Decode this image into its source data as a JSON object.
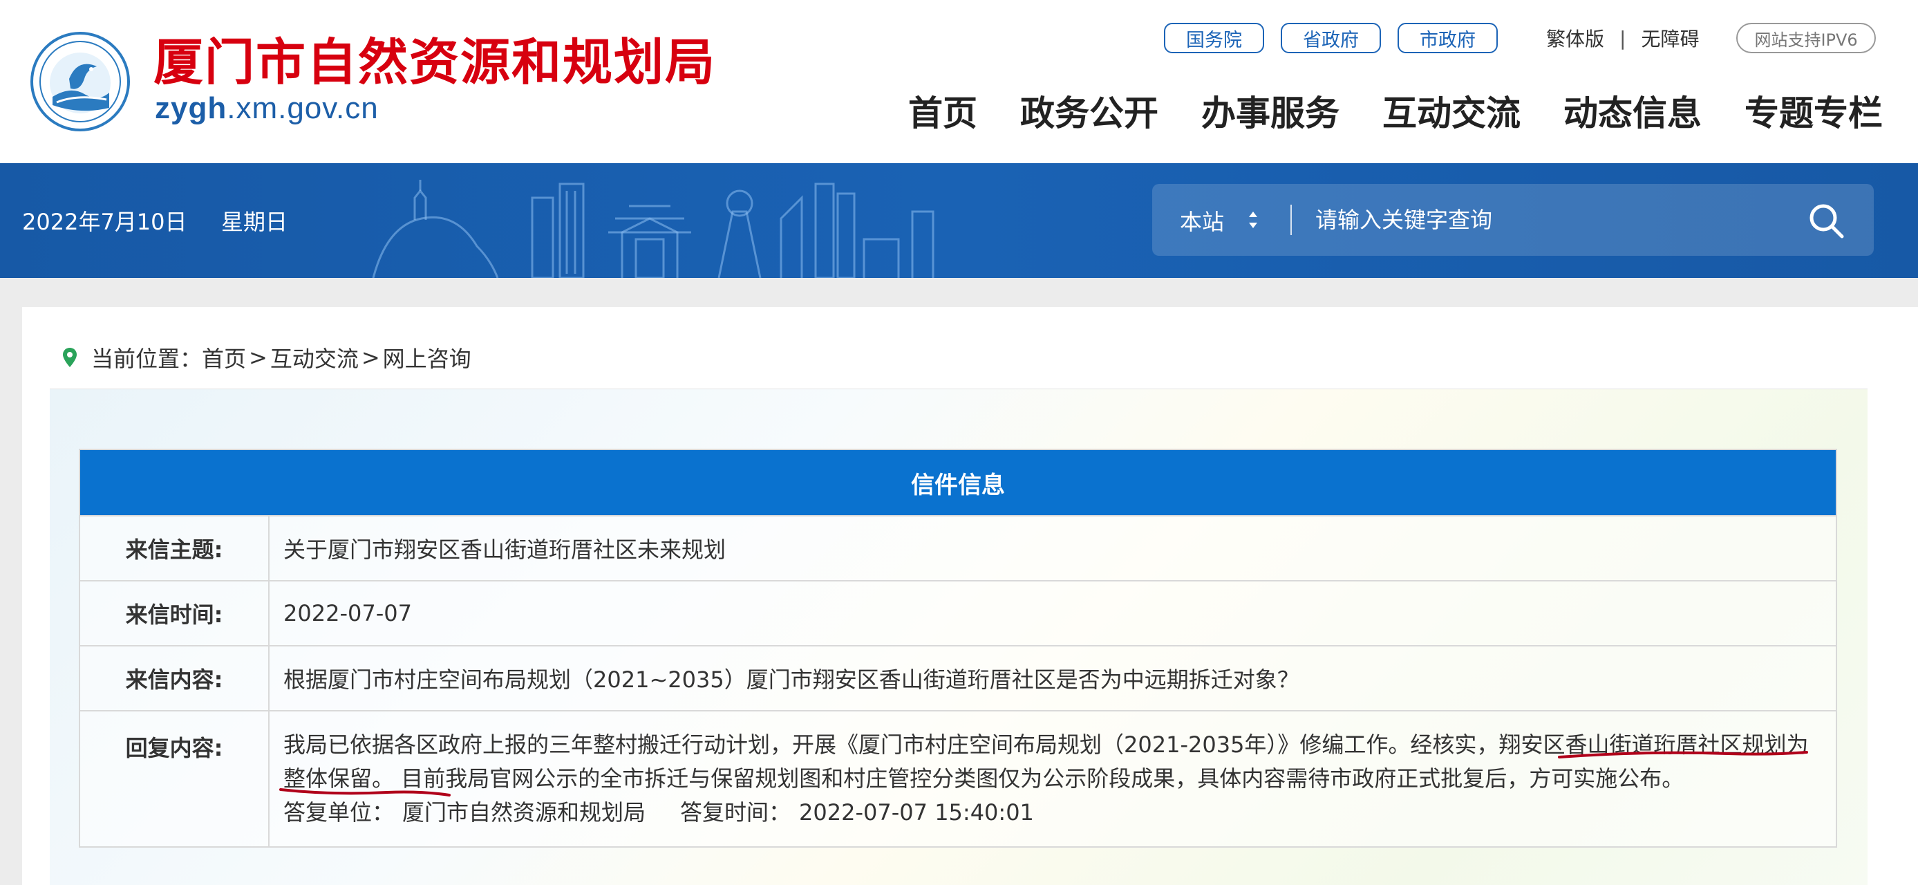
{
  "header": {
    "site_title": "厦门市自然资源和规划局",
    "site_domain_bold": "zygh",
    "site_domain_rest": ".xm.gov.cn",
    "top_pills": [
      "国务院",
      "省政府",
      "市政府"
    ],
    "traditional_link": "繁体版",
    "separator": "|",
    "accessibility_link": "无障碍",
    "ipv6_badge": "网站支持IPV6",
    "nav": [
      "首页",
      "政务公开",
      "办事服务",
      "互动交流",
      "动态信息",
      "专题专栏"
    ]
  },
  "banner": {
    "date": "2022年7月10日",
    "weekday": "星期日",
    "search_scope": "本站",
    "search_placeholder": "请输入关键字查询"
  },
  "breadcrumb": {
    "prefix": "当前位置：",
    "items": [
      "首页",
      "互动交流",
      "网上咨询"
    ],
    "separator": ">"
  },
  "letter": {
    "table_title": "信件信息",
    "subject_label": "来信主题:",
    "subject": "关于厦门市翔安区香山街道珩厝社区未来规划",
    "time_label": "来信时间:",
    "time": "2022-07-07",
    "content_label": "来信内容:",
    "content": "根据厦门市村庄空间布局规划（2021~2035）厦门市翔安区香山街道珩厝社区是否为中远期拆迁对象？",
    "reply_label": "回复内容:",
    "reply_part1": "我局已依据各区政府上报的三年整村搬迁行动计划，开展《厦门市村庄空间布局规划（2021-2035年）》修编工作。经核实，",
    "reply_highlight": "翔安区香山街道珩厝社区规划为整体保留",
    "reply_part2": "。 目前我局官网公示的全市拆迁与保留规划图和村庄管控分类图仅为公示阶段成果，具体内容需待市政府正式批复后，方可实施公布。",
    "reply_unit_label": "答复单位：",
    "reply_unit": "厦门市自然资源和规划局",
    "reply_time_label": "答复时间：",
    "reply_time": "2022-07-07 15:40:01"
  },
  "colors": {
    "brand_red": "#d7000f",
    "brand_blue": "#1c5ea8",
    "banner_blue": "#1a62b4",
    "table_header_blue": "#0a72cf",
    "annotation_red": "#b0001a"
  }
}
